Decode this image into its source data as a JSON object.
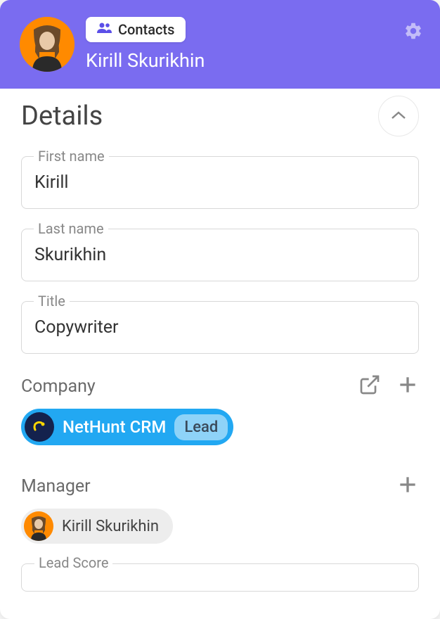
{
  "header": {
    "badge_label": "Contacts",
    "contact_name": "Kirill Skurikhin"
  },
  "details": {
    "title": "Details",
    "fields": {
      "first_name": {
        "label": "First name",
        "value": "Kirill"
      },
      "last_name": {
        "label": "Last name",
        "value": "Skurikhin"
      },
      "title": {
        "label": "Title",
        "value": "Copywriter"
      },
      "lead_score": {
        "label": "Lead Score",
        "value": ""
      }
    },
    "company": {
      "section_label": "Company",
      "name": "NetHunt CRM",
      "stage": "Lead"
    },
    "manager": {
      "section_label": "Manager",
      "name": "Kirill Skurikhin"
    }
  }
}
